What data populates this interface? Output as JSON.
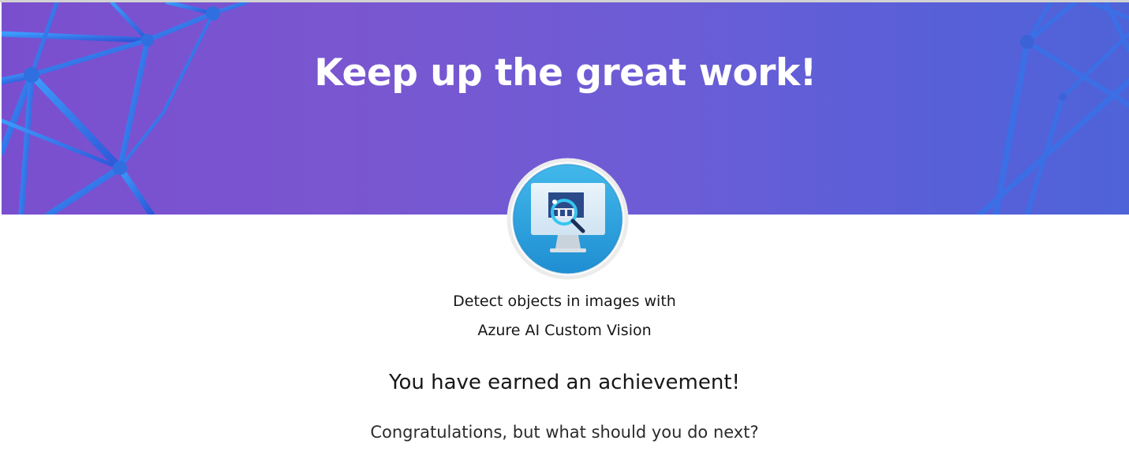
{
  "banner": {
    "title": "Keep up the great work!"
  },
  "badge": {
    "icon": "custom-vision-monitor-icon",
    "ring_color": "#e6e6e6",
    "fill_color": "#2fa8de"
  },
  "module": {
    "title_line1": "Detect objects in images with",
    "title_line2": "Azure AI Custom Vision"
  },
  "achievement": {
    "heading": "You have earned an achievement!",
    "subtext": "Congratulations, but what should you do next?"
  },
  "colors": {
    "banner_start": "#7a4fcf",
    "banner_end": "#4f63d8",
    "text": "#171717"
  }
}
